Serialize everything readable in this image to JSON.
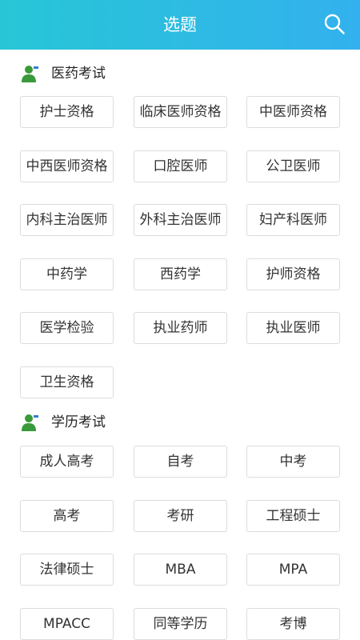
{
  "header": {
    "title": "选题",
    "search_icon": "search-icon"
  },
  "sections": [
    {
      "title": "医药考试",
      "icon": "person-icon",
      "items": [
        "护士资格",
        "临床医师资格",
        "中医师资格",
        "中西医师资格",
        "口腔医师",
        "公卫医师",
        "内科主治医师",
        "外科主治医师",
        "妇产科医师",
        "中药学",
        "西药学",
        "护师资格",
        "医学检验",
        "执业药师",
        "执业医师",
        "卫生资格"
      ]
    },
    {
      "title": "学历考试",
      "icon": "person-icon",
      "items": [
        "成人高考",
        "自考",
        "中考",
        "高考",
        "考研",
        "工程硕士",
        "法律硕士",
        "MBA",
        "MPA",
        "MPACC",
        "同等学历",
        "考博"
      ]
    }
  ],
  "colors": {
    "header_start": "#27c6d6",
    "header_end": "#33b1ee",
    "icon_green": "#3a9a3a"
  }
}
